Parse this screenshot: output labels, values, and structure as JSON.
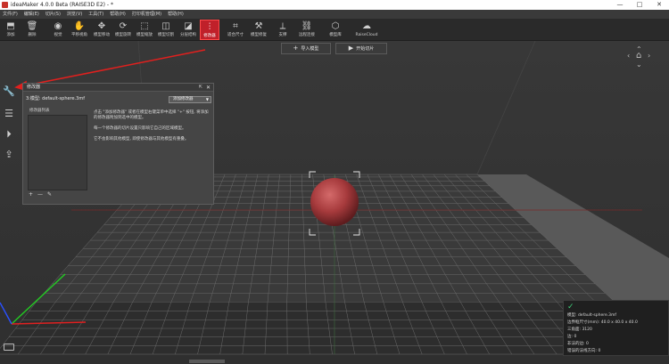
{
  "titlebar": {
    "title": "ideaMaker 4.0.0 Beta (RAISE3D E2) - *",
    "controls": [
      "—",
      "□",
      "✕"
    ]
  },
  "menu": [
    "文件(F)",
    "编辑(E)",
    "切片(S)",
    "浏览(V)",
    "工具(T)",
    "帮助(H)",
    "打印机管理(M)",
    "帮助(H)"
  ],
  "toolbar": [
    {
      "name": "add",
      "label": "添加",
      "icon": "import-icon"
    },
    {
      "name": "delete",
      "label": "删除",
      "icon": "trash-icon"
    },
    {
      "name": "view",
      "label": "视觉",
      "icon": "eye-icon"
    },
    {
      "name": "pan",
      "label": "平移视角",
      "icon": "hand-icon"
    },
    {
      "name": "move",
      "label": "模型移动",
      "icon": "move-icon"
    },
    {
      "name": "rotate",
      "label": "模型旋转",
      "icon": "rotate-icon"
    },
    {
      "name": "scale",
      "label": "模型缩放",
      "icon": "scale-icon"
    },
    {
      "name": "cut",
      "label": "模型切割",
      "icon": "cut-icon"
    },
    {
      "name": "split",
      "label": "分层结构",
      "icon": "layers-icon"
    },
    {
      "name": "modifier",
      "label": "修改器",
      "icon": "modifier-icon",
      "active": true
    },
    {
      "name": "fit",
      "label": "适合尺寸",
      "icon": "fit-icon"
    },
    {
      "name": "repair",
      "label": "模型修复",
      "icon": "repair-icon"
    },
    {
      "name": "support",
      "label": "支撑",
      "icon": "support-icon"
    },
    {
      "name": "remote",
      "label": "远程连接",
      "icon": "link-icon"
    },
    {
      "name": "gallery",
      "label": "模型库",
      "icon": "hex-icon"
    },
    {
      "name": "cloud",
      "label": "RaiseCloud",
      "icon": "cloud-icon"
    }
  ],
  "top_buttons": {
    "import_label": "导入模型",
    "slice_label": "开始切片"
  },
  "modifier_panel": {
    "title": "修改器",
    "pin": "⇱",
    "close": "✕",
    "model_label": "3:模型: default-sphere.3mf",
    "add_button": "添加修改器",
    "list_title": "修改器列表",
    "help": [
      "点击 \"添加修改器\" 或者在模型右键菜单中选择 \"+\" 按钮, 将添加的修改器附加到选中的模型。",
      "每一个修改器的切片设置只影响它自己的区域模型。",
      "它不会影响其他模型, 即使修改器与其他模型有重叠。"
    ],
    "list_controls": [
      "+",
      "—",
      "✎"
    ]
  },
  "info_panel": {
    "lines": [
      "模型: default-sphere.3mf",
      "边界框尺寸(mm): 40.0 x 40.0 x 40.0",
      "三角面: 3120",
      "边: 0",
      "非法的边: 0",
      "错误的法线方向: 0"
    ]
  },
  "colors": {
    "accent": "#c0202a",
    "annotation": "#e0201e",
    "sphere": "#a63a3c",
    "grid": "#6b6b6b",
    "axis_x": "#e02020",
    "axis_y": "#22cc22",
    "axis_z": "#2a50ff"
  }
}
